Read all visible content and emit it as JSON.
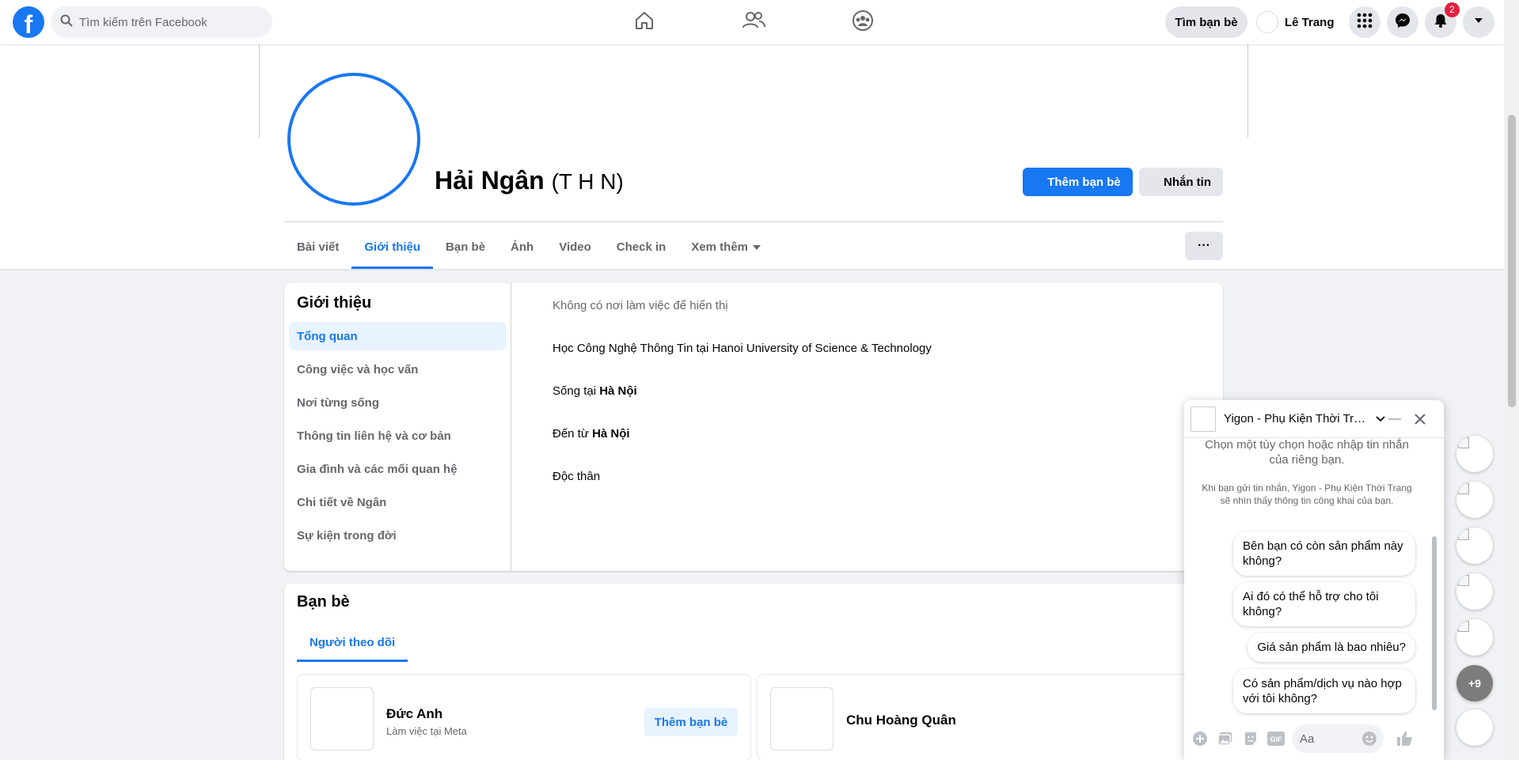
{
  "topbar": {
    "logo": "f",
    "search_placeholder": "Tìm kiếm trên Facebook",
    "nav_icons": [
      "home-icon",
      "friends-icon",
      "groups-icon"
    ],
    "find_friends_label": "Tìm bạn bè",
    "user_name": "Lê Trang",
    "notification_count": "2",
    "accent_color": "#1877f2"
  },
  "profile": {
    "name": "Hải Ngân",
    "alternate_name": "(T H N)",
    "add_friend_label": "Thêm bạn bè",
    "message_label": "Nhắn tin",
    "more_label": "···",
    "tabs": [
      {
        "label": "Bài viết"
      },
      {
        "label": "Giới thiệu"
      },
      {
        "label": "Bạn bè"
      },
      {
        "label": "Ảnh"
      },
      {
        "label": "Video"
      },
      {
        "label": "Check in"
      },
      {
        "label": "Xem thêm"
      }
    ],
    "active_tab": "Giới thiệu"
  },
  "about": {
    "title": "Giới thiệu",
    "menu": [
      {
        "label": "Tổng quan"
      },
      {
        "label": "Công việc và học vấn"
      },
      {
        "label": "Nơi từng sống"
      },
      {
        "label": "Thông tin liên hệ và cơ bản"
      },
      {
        "label": "Gia đình và các mối quan hệ"
      },
      {
        "label": "Chi tiết về Ngân"
      },
      {
        "label": "Sự kiện trong đời"
      }
    ],
    "overview": {
      "work": "Không có nơi làm việc để hiển thị",
      "education": "Học Công Nghệ Thông Tin tại Hanoi University of Science & Technology",
      "lives_prefix": "Sống tại",
      "lives_place": "Hà Nội",
      "from_prefix": "Đến từ",
      "from_place": "Hà Nội",
      "relationship": "Độc thân"
    }
  },
  "friends": {
    "title": "Bạn bè",
    "tab_label": "Người theo dõi",
    "items": [
      {
        "name": "Đức Anh",
        "subtitle": "Làm việc tại Meta",
        "button": "Thêm bạn bè"
      },
      {
        "name": "Chu Hoàng Quân"
      }
    ]
  },
  "chat": {
    "title": "Yigon - Phụ Kiện Thời Trang",
    "intro": "Chọn một tùy chọn hoặc nhập tin nhắn của riêng bạn.",
    "disclaimer": "Khi bạn gửi tin nhắn, Yigon - Phụ Kiện Thời Trang sẽ nhìn thấy thông tin công khai của bạn.",
    "quick_replies": [
      "Bên bạn có còn sản phẩm này không?",
      "Ai đó có thể hỗ trợ cho tôi không?",
      "Giá sản phẩm là bao nhiêu?",
      "Có sản phẩm/dịch vụ nào hợp với tôi không?"
    ],
    "input_placeholder": "Aa"
  },
  "contacts": {
    "more_count": "+9"
  }
}
